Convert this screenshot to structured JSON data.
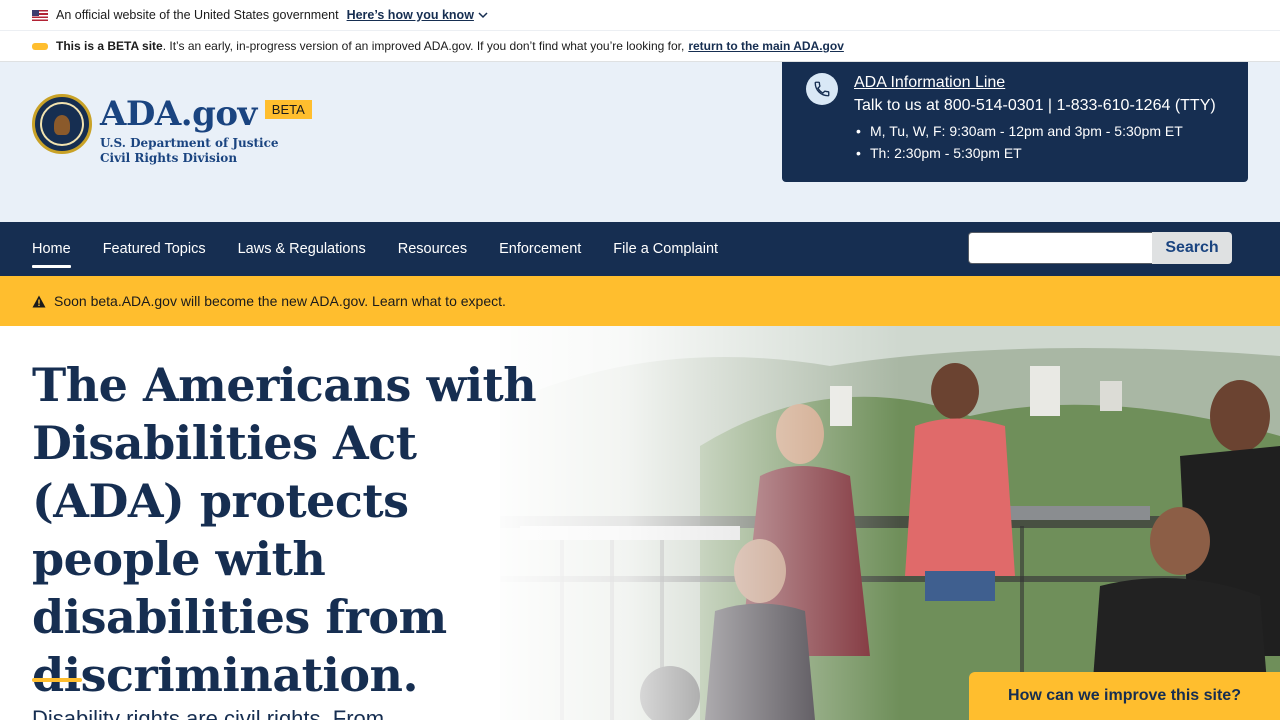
{
  "gov_banner": {
    "text": "An official website of the United States government",
    "link": "Here’s how you know"
  },
  "beta_notice": {
    "bold": "This is a BETA site",
    "text": ". It’s an early, in-progress version of an improved ADA.gov. If you don’t find what you’re looking for,",
    "link": "return to the main ADA.gov"
  },
  "header": {
    "site_name": "ADA.gov",
    "beta_tag": "BETA",
    "dept_line1": "U.S. Department of Justice",
    "dept_line2": "Civil Rights Division"
  },
  "info_line": {
    "title": "ADA Information Line",
    "phones": "Talk to us at 800-514-0301 | 1-833-610-1264 (TTY)",
    "hours": [
      "M, Tu, W, F: 9:30am - 12pm and 3pm - 5:30pm ET",
      "Th: 2:30pm - 5:30pm ET"
    ]
  },
  "nav": {
    "items": [
      "Home",
      "Featured Topics",
      "Laws & Regulations",
      "Resources",
      "Enforcement",
      "File a Complaint"
    ],
    "active": "Home",
    "search_label": "Search",
    "search_value": ""
  },
  "alert": {
    "text": "Soon beta.ADA.gov will become the new ADA.gov. Learn what to expect."
  },
  "hero": {
    "title": "The Americans with Disabilities Act (ADA) protects people with disabilities from discrimination.",
    "subtitle": "Disability rights are civil rights. From"
  },
  "feedback": {
    "label": "How can we improve this site?"
  },
  "colors": {
    "navy": "#162e51",
    "blue": "#1a4480",
    "gold": "#ffbe2e",
    "header_bg": "#e9f0f8"
  }
}
